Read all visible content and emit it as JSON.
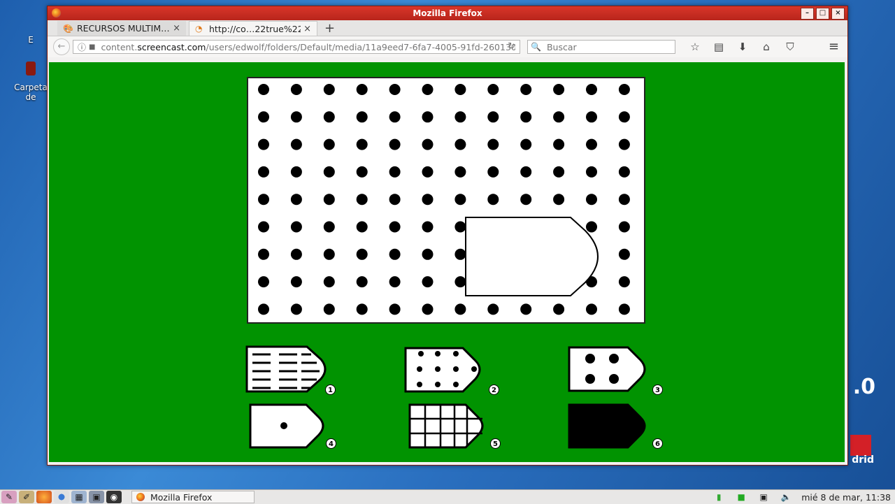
{
  "desktop": {
    "icons": [
      {
        "label": "E"
      },
      {
        "label": "Carpeta de"
      }
    ],
    "version_text": ".0",
    "logo_text": "drid"
  },
  "window": {
    "title": "Mozilla Firefox",
    "buttons": {
      "minimize": "–",
      "maximize": "□",
      "close": "×"
    }
  },
  "tabs": [
    {
      "label": "RECURSOS MULTIM…",
      "icon": "palette-icon",
      "active": false
    },
    {
      "label": "http://co…22true%22",
      "icon": "rss-icon",
      "active": true
    }
  ],
  "navigation": {
    "url_prefix": "content.",
    "url_host": "screencast.com",
    "url_path": "/users/edwolf/folders/Default/media/11a9eed7-6fa7-4005-91fd-2601301",
    "search_placeholder": "Buscar"
  },
  "puzzle": {
    "grid_rows": 9,
    "grid_cols": 12,
    "options": [
      {
        "number": "1",
        "pattern": "dashes"
      },
      {
        "number": "2",
        "pattern": "small-dots"
      },
      {
        "number": "3",
        "pattern": "four-big-dots"
      },
      {
        "number": "4",
        "pattern": "single-dot"
      },
      {
        "number": "5",
        "pattern": "grid"
      },
      {
        "number": "6",
        "pattern": "solid-black"
      }
    ]
  },
  "taskbar": {
    "task_label": "Mozilla Firefox",
    "clock": "mié 8 de mar, 11:38"
  }
}
